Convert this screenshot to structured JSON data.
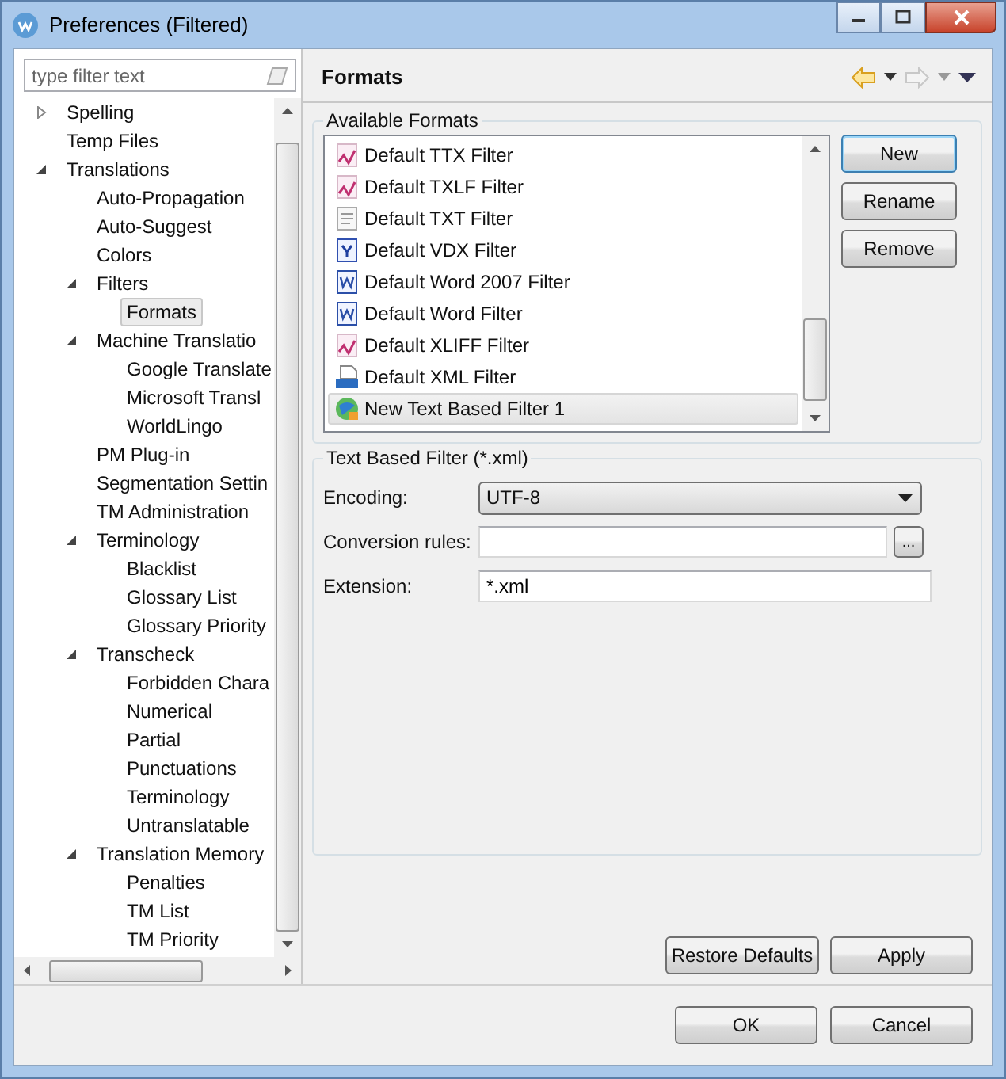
{
  "window": {
    "title": "Preferences (Filtered)"
  },
  "sidebar": {
    "filter": {
      "placeholder": "type filter text"
    },
    "tree": [
      {
        "label": "Spelling",
        "expanded": false,
        "selected": false
      },
      {
        "label": "Temp Files",
        "selected": false
      },
      {
        "label": "Translations",
        "expanded": true,
        "selected": false,
        "children": [
          {
            "label": "Auto-Propagation",
            "selected": false
          },
          {
            "label": "Auto-Suggest",
            "selected": false
          },
          {
            "label": "Colors",
            "selected": false
          },
          {
            "label": "Filters",
            "expanded": true,
            "selected": false,
            "children": [
              {
                "label": "Formats",
                "selected": true
              }
            ]
          },
          {
            "label": "Machine Translatio",
            "expanded": true,
            "selected": false,
            "children": [
              {
                "label": "Google Translate",
                "selected": false
              },
              {
                "label": "Microsoft Transl",
                "selected": false
              },
              {
                "label": "WorldLingo",
                "selected": false
              }
            ]
          },
          {
            "label": "PM Plug-in",
            "selected": false
          },
          {
            "label": "Segmentation Settin",
            "selected": false
          },
          {
            "label": "TM Administration",
            "selected": false
          },
          {
            "label": "Terminology",
            "expanded": true,
            "selected": false,
            "children": [
              {
                "label": "Blacklist",
                "selected": false
              },
              {
                "label": "Glossary List",
                "selected": false
              },
              {
                "label": "Glossary Priority",
                "selected": false
              }
            ]
          },
          {
            "label": "Transcheck",
            "expanded": true,
            "selected": false,
            "children": [
              {
                "label": "Forbidden Chara",
                "selected": false
              },
              {
                "label": "Numerical",
                "selected": false
              },
              {
                "label": "Partial",
                "selected": false
              },
              {
                "label": "Punctuations",
                "selected": false
              },
              {
                "label": "Terminology",
                "selected": false
              },
              {
                "label": "Untranslatable",
                "selected": false
              }
            ]
          },
          {
            "label": "Translation Memory",
            "expanded": true,
            "selected": false,
            "children": [
              {
                "label": "Penalties",
                "selected": false
              },
              {
                "label": "TM List",
                "selected": false
              },
              {
                "label": "TM Priority",
                "selected": false
              }
            ]
          }
        ]
      }
    ]
  },
  "page": {
    "title": "Formats",
    "available": {
      "title": "Available Formats",
      "items": [
        {
          "label": "Default TTX Filter",
          "kind": "pen",
          "selected": false
        },
        {
          "label": "Default TXLF Filter",
          "kind": "pen",
          "selected": false
        },
        {
          "label": "Default TXT Filter",
          "kind": "text",
          "selected": false
        },
        {
          "label": "Default VDX Filter",
          "kind": "vdx",
          "selected": false
        },
        {
          "label": "Default Word 2007 Filter",
          "kind": "word",
          "selected": false
        },
        {
          "label": "Default Word Filter",
          "kind": "word",
          "selected": false
        },
        {
          "label": "Default XLIFF Filter",
          "kind": "pen",
          "selected": false
        },
        {
          "label": "Default XML Filter",
          "kind": "xml",
          "selected": false
        },
        {
          "label": "New Text Based Filter 1",
          "kind": "globe",
          "selected": true
        }
      ],
      "buttons": [
        {
          "label": "New",
          "focused": true
        },
        {
          "label": "Rename",
          "focused": false
        },
        {
          "label": "Remove",
          "focused": false
        }
      ]
    },
    "filter": {
      "title": "Text Based Filter (*.xml)",
      "encoding": {
        "label": "Encoding:",
        "value": "UTF-8"
      },
      "conversion": {
        "label": "Conversion rules:",
        "button": "..."
      },
      "extension": {
        "label": "Extension:",
        "value": "*.xml"
      }
    },
    "buttons": [
      "Restore Defaults",
      "Apply"
    ]
  },
  "dialog_buttons": [
    "OK",
    "Cancel"
  ]
}
